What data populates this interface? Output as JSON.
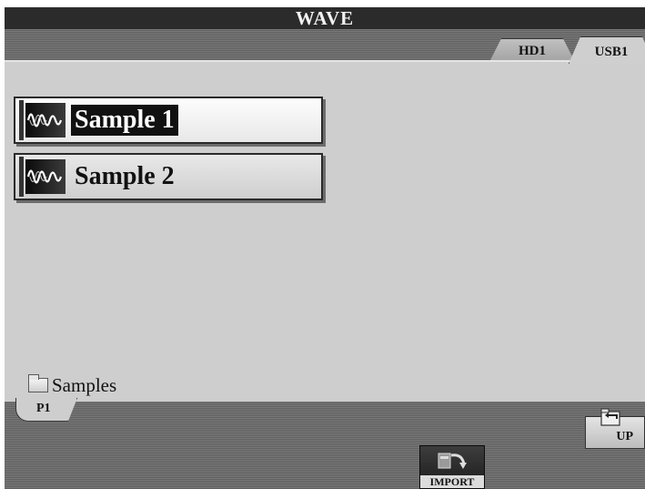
{
  "header": {
    "title": "WAVE"
  },
  "drive_tabs": [
    {
      "label": "HD1",
      "selected": false
    },
    {
      "label": "USB1",
      "selected": true
    }
  ],
  "files": [
    {
      "label": "Sample 1",
      "icon": "waveform-icon",
      "selected": true
    },
    {
      "label": "Sample 2",
      "icon": "waveform-icon",
      "selected": false
    }
  ],
  "folder": {
    "name": "Samples",
    "icon": "folder-icon"
  },
  "pagination": {
    "current_page": "P1"
  },
  "actions": {
    "up_label": "UP",
    "import_label": "IMPORT"
  }
}
